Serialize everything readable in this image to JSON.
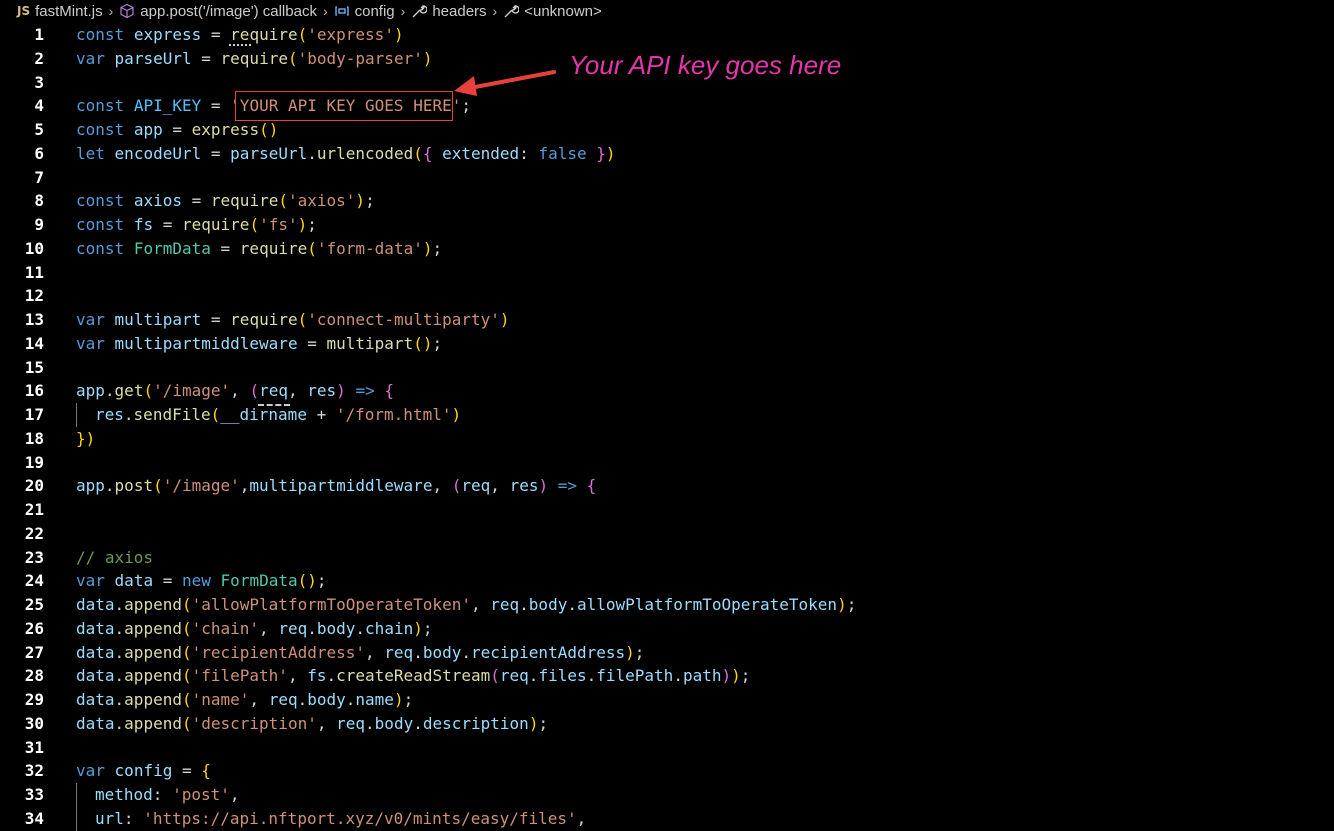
{
  "breadcrumb": {
    "file_badge": "JS",
    "file_name": "fastMint.js",
    "items": [
      {
        "label": "app.post('/image') callback",
        "icon": "cube-icon"
      },
      {
        "label": "config",
        "icon": "variable-icon"
      },
      {
        "label": "headers",
        "icon": "wrench-icon"
      },
      {
        "label": "<unknown>",
        "icon": "wrench-icon"
      }
    ]
  },
  "annotation": {
    "text": "Your API key goes here",
    "color": "#e535ab",
    "box_color": "#e8413c"
  },
  "editor": {
    "line_numbers": [
      "1",
      "2",
      "3",
      "4",
      "5",
      "6",
      "7",
      "8",
      "9",
      "10",
      "11",
      "12",
      "13",
      "14",
      "15",
      "16",
      "17",
      "18",
      "19",
      "20",
      "21",
      "22",
      "23",
      "24",
      "25",
      "26",
      "27",
      "28",
      "29",
      "30",
      "31",
      "32",
      "33",
      "34"
    ],
    "lines": [
      "const express = require('express')",
      "var parseUrl = require('body-parser')",
      "",
      "const API_KEY = 'YOUR API KEY GOES HERE';",
      "const app = express()",
      "let encodeUrl = parseUrl.urlencoded({ extended: false })",
      "",
      "const axios = require('axios');",
      "const fs = require('fs');",
      "const FormData = require('form-data');",
      "",
      "",
      "var multipart = require('connect-multiparty')",
      "var multipartmiddleware = multipart();",
      "",
      "app.get('/image', (req, res) => {",
      "  res.sendFile(__dirname + '/form.html')",
      "})",
      "",
      "app.post('/image',multipartmiddleware, (req, res) => {",
      "",
      "",
      "// axios",
      "var data = new FormData();",
      "data.append('allowPlatformToOperateToken', req.body.allowPlatformToOperateToken);",
      "data.append('chain', req.body.chain);",
      "data.append('recipientAddress', req.body.recipientAddress);",
      "data.append('filePath', fs.createReadStream(req.files.filePath.path));",
      "data.append('name', req.body.name);",
      "data.append('description', req.body.description);",
      "",
      "var config = {",
      "  method: 'post',",
      "  url: 'https://api.nftport.xyz/v0/mints/easy/files',"
    ]
  }
}
